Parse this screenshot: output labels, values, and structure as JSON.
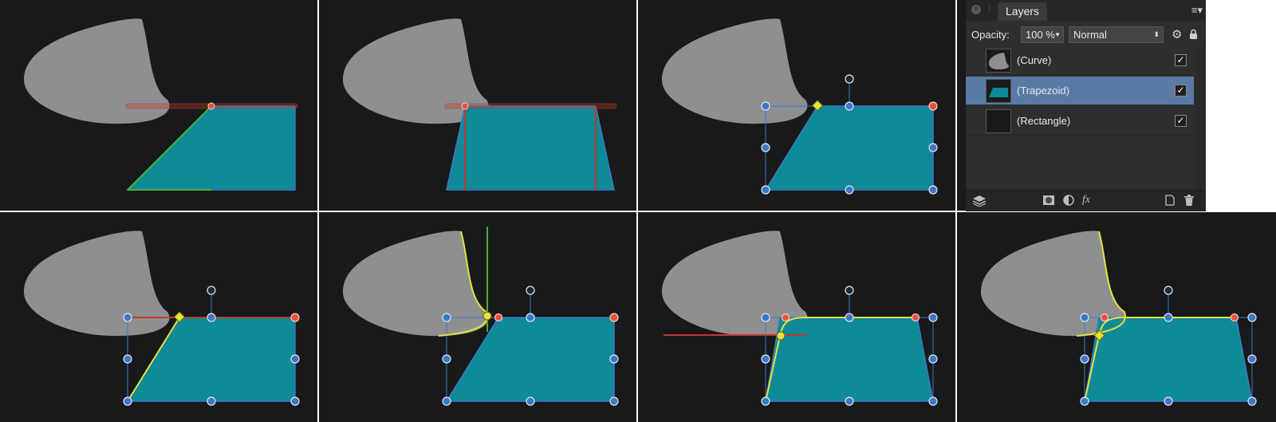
{
  "layers_panel": {
    "title": "Layers",
    "opacity_label": "Opacity:",
    "opacity_value": "100 %",
    "blend_mode": "Normal",
    "layers": [
      {
        "name": "(Curve)",
        "visible": true,
        "selected": false,
        "thumb": "curve"
      },
      {
        "name": "(Trapezoid)",
        "visible": true,
        "selected": true,
        "thumb": "trapezoid"
      },
      {
        "name": "(Rectangle)",
        "visible": true,
        "selected": false,
        "thumb": "rectangle"
      }
    ],
    "icons": [
      "close-icon",
      "panel-menu-icon",
      "settings-icon",
      "lock-icon",
      "layers-icon",
      "mask-icon",
      "adjustment-icon",
      "fx-icon",
      "new-layer-icon",
      "delete-icon"
    ],
    "check_mark": "✓"
  },
  "colors": {
    "canvas_bg": "#17191b",
    "gray_shape": "#8e8f91",
    "teal_shape": "#0f8a98",
    "selection_blue": "#3f78c2",
    "guide_red": "#c0392b",
    "guide_green": "#4caf32",
    "highlight_yellow": "#e6e23a",
    "panel_selected": "#5a7aa6"
  }
}
